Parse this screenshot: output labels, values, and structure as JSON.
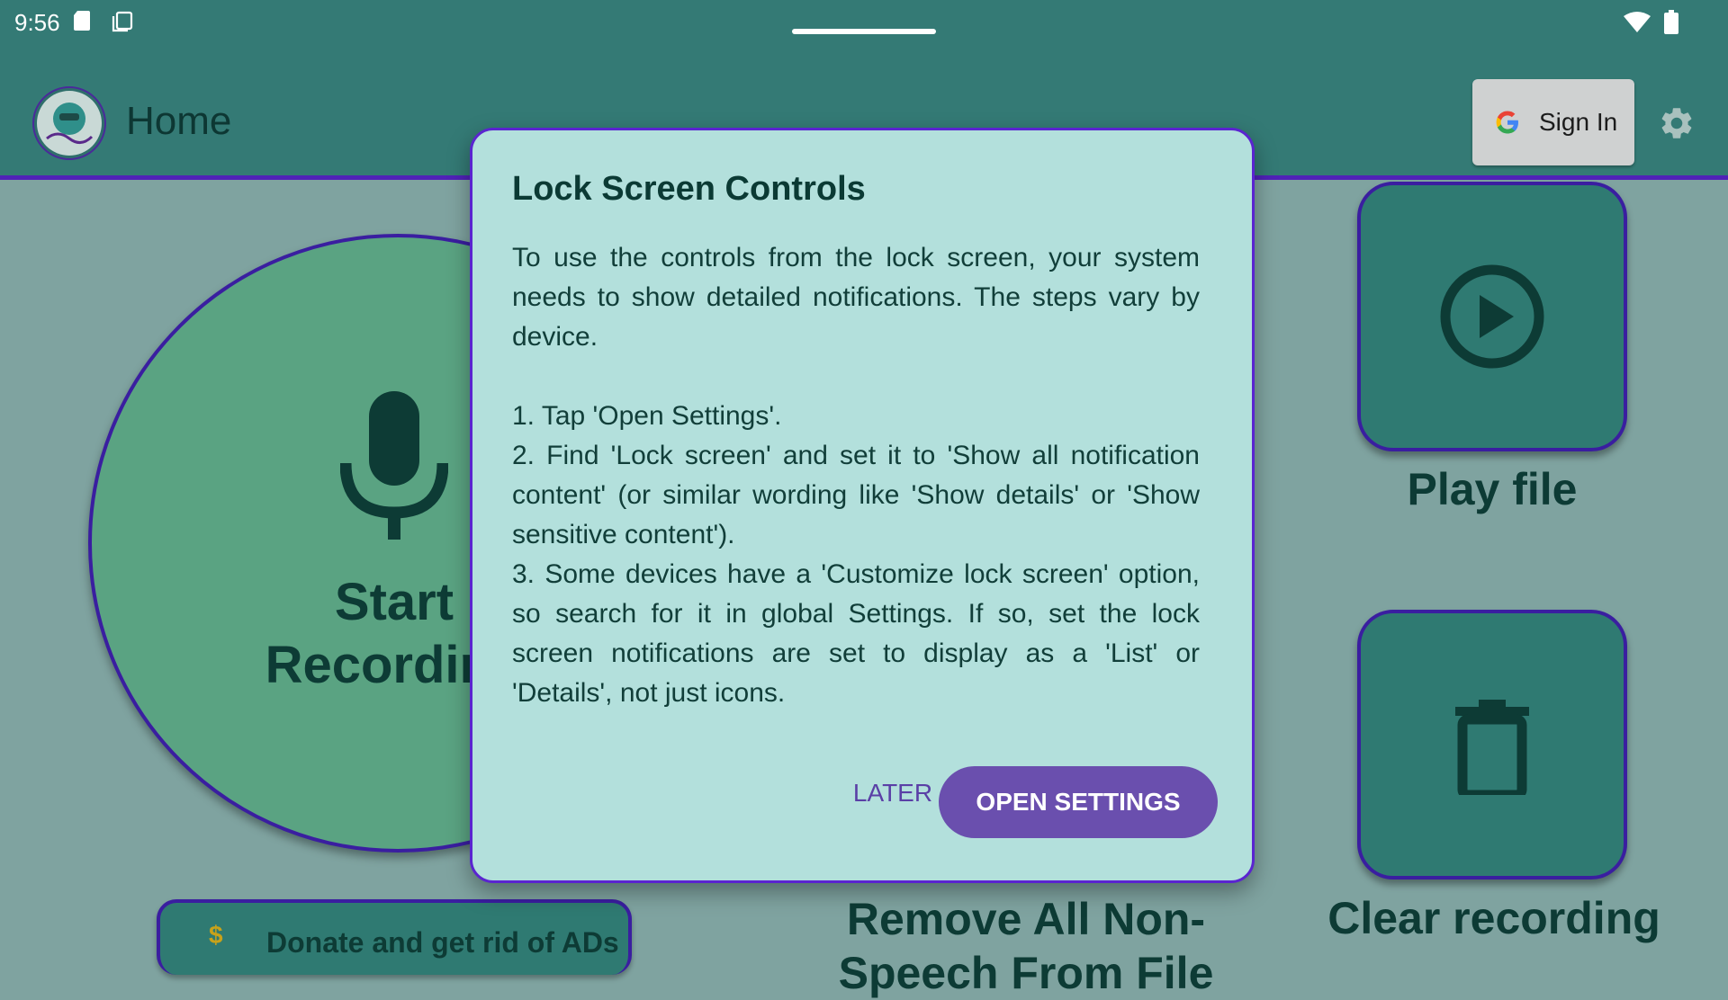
{
  "status_bar": {
    "time": "9:56",
    "icons": [
      "sd-card-icon",
      "copy-icon",
      "wifi-icon",
      "battery-icon"
    ]
  },
  "app_bar": {
    "title": "Home",
    "sign_in_label": "Sign In",
    "icons": [
      "app-logo",
      "google-icon",
      "gear-icon"
    ]
  },
  "main": {
    "record_label": "Start Recording",
    "play_file_label": "Play file",
    "clear_recording_label": "Clear recording",
    "remove_non_speech_label": "Remove All Non-Speech From File",
    "donate_label": "Donate and get rid of ADs",
    "donate_icon": "$"
  },
  "dialog": {
    "title": "Lock Screen Controls",
    "intro": "To use the controls from the lock screen, your system needs to show detailed notifications. The steps vary by device.",
    "steps": [
      "1. Tap 'Open Settings'.",
      "2. Find 'Lock screen' and set it to 'Show all notification content' (or similar wording like 'Show details' or 'Show sensitive content').",
      "3. Some devices have a 'Customize lock screen' option, so search for it in global Settings. If so, set the lock screen notifications are set to display as a 'List' or 'Details', not just icons."
    ],
    "later_button": "LATER",
    "open_settings_button": "OPEN SETTINGS"
  },
  "colors": {
    "app_bar": "#347a75",
    "accent_border": "#5022b8",
    "dialog_bg": "#b3e0dc",
    "primary_button": "#6a4fae",
    "record_circle": "#5aa382",
    "tile": "#2f7a72"
  }
}
